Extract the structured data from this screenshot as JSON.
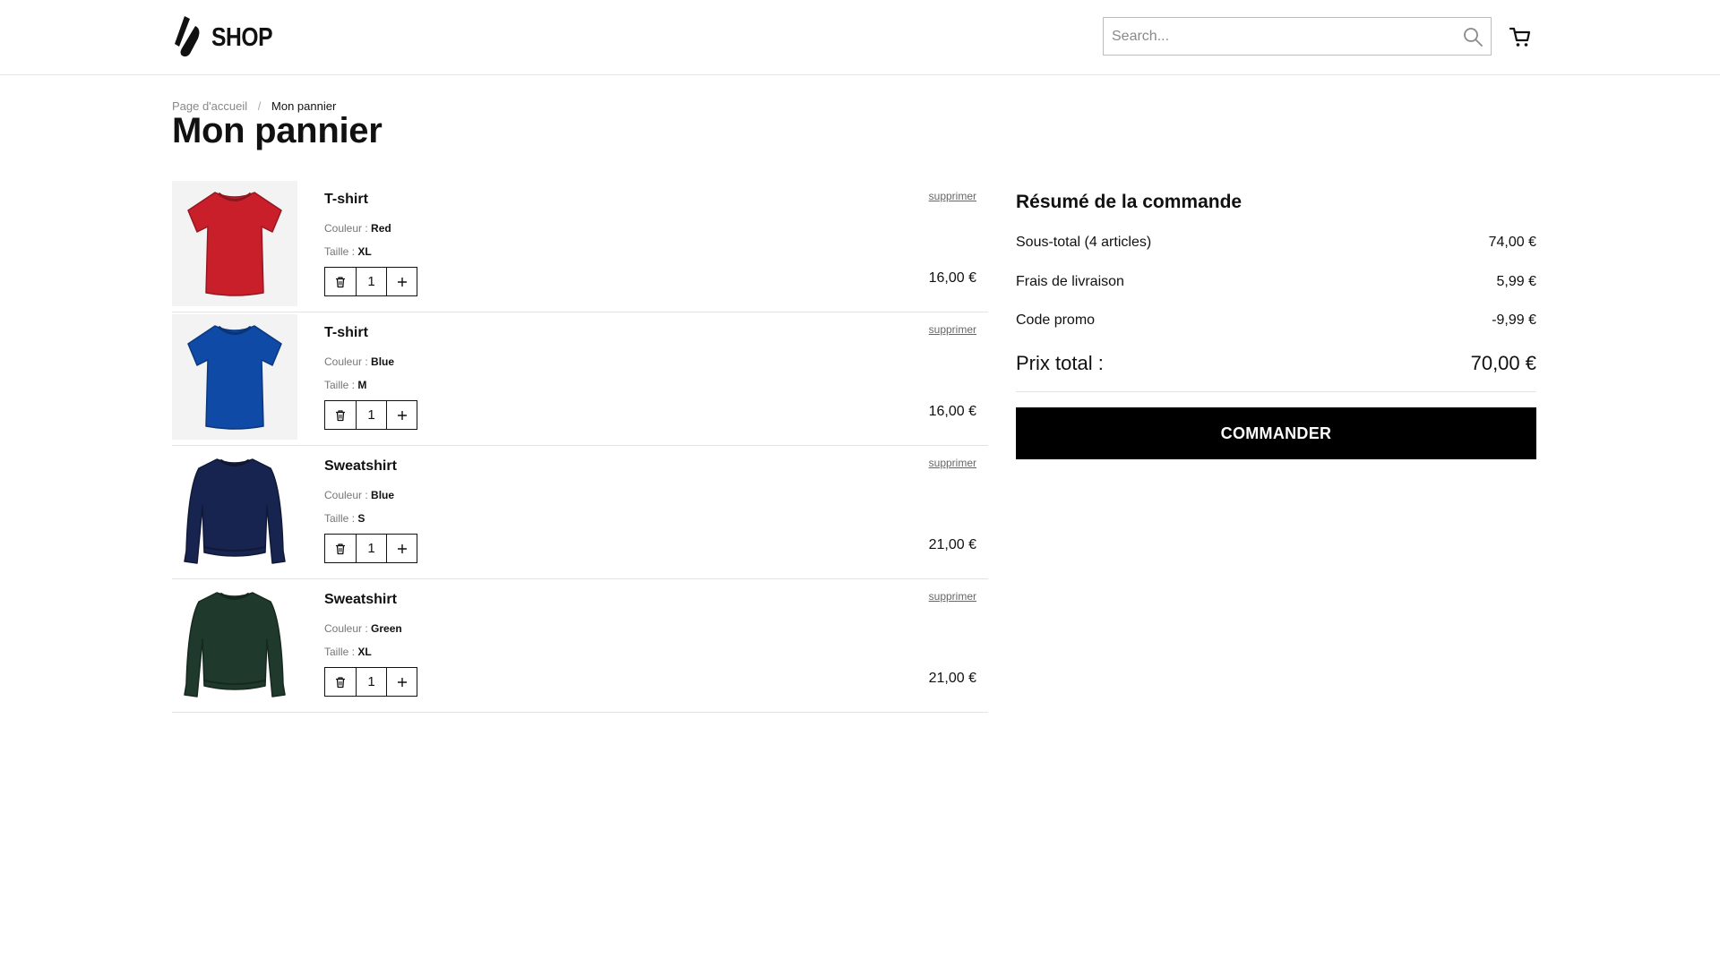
{
  "header": {
    "logo_text": "SHOP",
    "search_placeholder": "Search...",
    "icons": {
      "search": "search-icon",
      "cart": "cart-icon",
      "logo": "slash-logo-icon"
    }
  },
  "breadcrumb": {
    "home": "Page d'accueil",
    "separator": "/",
    "current": "Mon pannier"
  },
  "page_title": "Mon pannier",
  "cart": {
    "remove_label": "supprimer",
    "color_label": "Couleur :",
    "size_label": "Taille :",
    "items": [
      {
        "name": "T-shirt",
        "color": "Red",
        "size": "XL",
        "qty": "1",
        "price": "16,00 €",
        "swatch": "#c91f2b",
        "kind": "tshirt"
      },
      {
        "name": "T-shirt",
        "color": "Blue",
        "size": "M",
        "qty": "1",
        "price": "16,00 €",
        "swatch": "#0e4aa6",
        "kind": "tshirt"
      },
      {
        "name": "Sweatshirt",
        "color": "Blue",
        "size": "S",
        "qty": "1",
        "price": "21,00 €",
        "swatch": "#17244f",
        "kind": "sweatshirt"
      },
      {
        "name": "Sweatshirt",
        "color": "Green",
        "size": "XL",
        "qty": "1",
        "price": "21,00 €",
        "swatch": "#1f3a2c",
        "kind": "sweatshirt"
      }
    ]
  },
  "summary": {
    "title": "Résumé de la commande",
    "subtotal_label": "Sous-total (4 articles)",
    "subtotal_value": "74,00 €",
    "shipping_label": "Frais de livraison",
    "shipping_value": "5,99 €",
    "promo_label": "Code promo",
    "promo_value": "-9,99 €",
    "total_label": "Prix total :",
    "total_value": "70,00 €",
    "checkout_label": "COMMANDER"
  },
  "colors": {
    "accent": "#000000",
    "divider": "#e3e3e3",
    "muted_text": "#888888"
  }
}
